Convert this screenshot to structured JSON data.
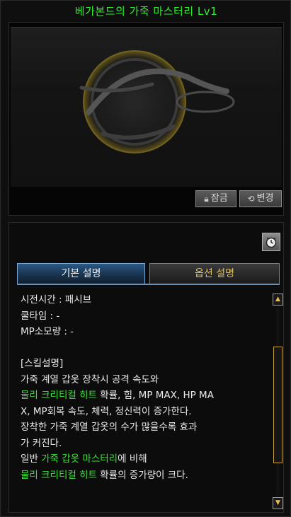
{
  "window": {
    "title": "베가본드의 가죽 마스터리 Lv1"
  },
  "top_panel": {
    "lock_button": {
      "icon": "lock-icon",
      "label": "잠금"
    },
    "change_button": {
      "icon": "refresh-icon",
      "label": "변경"
    }
  },
  "bottom_panel": {
    "clock_button": {
      "icon": "clock-icon"
    },
    "tabs": [
      {
        "label": "기본 설명",
        "active": true
      },
      {
        "label": "옵션 설명",
        "active": false
      }
    ],
    "details": {
      "cast_time": "시전시간 : 패시브",
      "cooldown": "쿨타임 : -",
      "mp_cost": "MP소모량 : -"
    },
    "description_header": "[스킬설명]",
    "description": {
      "l1": "가죽 계열 갑옷 장착시 공격 속도와",
      "l2_hl": "물리 크리티컬 히트",
      "l2_rest": " 확률, 힘, MP MAX, HP MA",
      "l3": "X, MP회복 속도, 체력, 정신력이 증가한다.",
      "l4": "장착한 가죽 계열 갑옷의 수가 많을수록 효과",
      "l5": "가 커진다.",
      "l6_pre": "일반 ",
      "l6_hl": "가죽 갑옷 마스터리",
      "l6_rest": "에 비해",
      "l7_hl": "물리 크리티컬 히트",
      "l7_rest": " 확률의 증가량이 크다."
    },
    "scrollbar": {
      "up_icon": "arrow-up-icon",
      "down_icon": "arrow-down-icon",
      "position": 0.55
    }
  },
  "colors": {
    "title": "#2ef02e",
    "highlight": "#39e339",
    "active_tab": "#2a5a86",
    "scroll_accent": "#c7a23a"
  }
}
